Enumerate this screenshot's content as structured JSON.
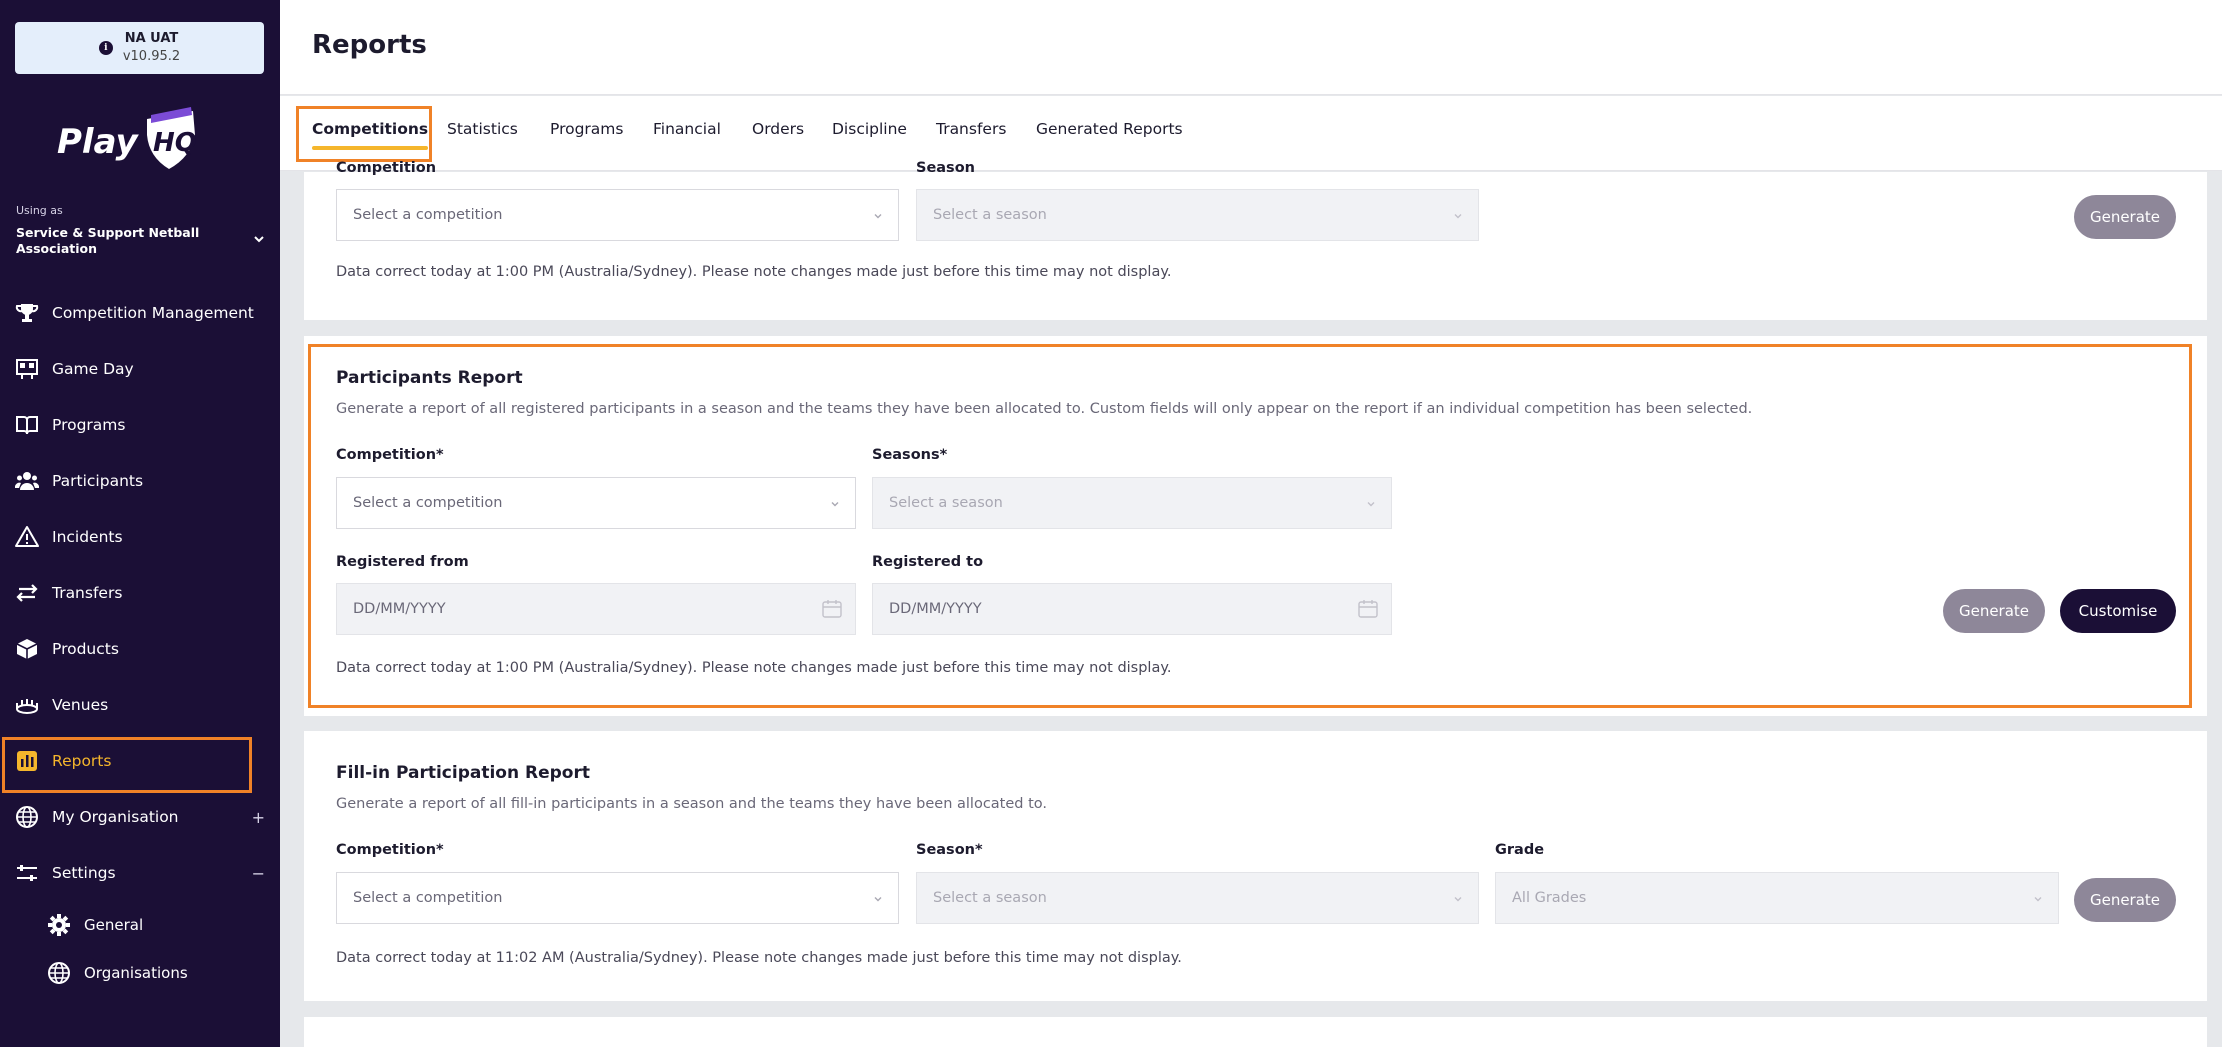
{
  "env": {
    "name": "NA UAT",
    "version": "v10.95.2"
  },
  "brand": {
    "logo_text": "PlayHQ"
  },
  "org": {
    "using_as": "Using as",
    "name": "Service & Support Netball Association"
  },
  "nav": [
    {
      "label": "Competition Management",
      "icon": "trophy-icon"
    },
    {
      "label": "Game Day",
      "icon": "scoreboard-icon"
    },
    {
      "label": "Programs",
      "icon": "book-icon"
    },
    {
      "label": "Participants",
      "icon": "people-icon"
    },
    {
      "label": "Incidents",
      "icon": "warning-icon"
    },
    {
      "label": "Transfers",
      "icon": "arrows-icon"
    },
    {
      "label": "Products",
      "icon": "box-icon"
    },
    {
      "label": "Venues",
      "icon": "stadium-icon"
    },
    {
      "label": "Reports",
      "icon": "reports-icon",
      "active": true
    },
    {
      "label": "My Organisation",
      "icon": "globe-icon",
      "toggle": "+"
    },
    {
      "label": "Settings",
      "icon": "sliders-icon",
      "toggle": "−"
    }
  ],
  "subnav": [
    {
      "label": "General",
      "icon": "gear-icon"
    },
    {
      "label": "Organisations",
      "icon": "globe-icon"
    }
  ],
  "page": {
    "title": "Reports"
  },
  "tabs": [
    {
      "label": "Competitions",
      "active": true
    },
    {
      "label": "Statistics"
    },
    {
      "label": "Programs"
    },
    {
      "label": "Financial"
    },
    {
      "label": "Orders"
    },
    {
      "label": "Discipline"
    },
    {
      "label": "Transfers"
    },
    {
      "label": "Generated Reports"
    }
  ],
  "card1": {
    "competition_label": "Competition",
    "season_label": "Season",
    "competition_placeholder": "Select a competition",
    "season_placeholder": "Select a season",
    "generate": "Generate",
    "note": "Data correct today at 1:00 PM (Australia/Sydney). Please note changes made just before this time may not display."
  },
  "participants": {
    "title": "Participants Report",
    "desc": "Generate a report of all registered participants in a season and the teams they have been allocated to. Custom fields will only appear on the report if an individual competition has been selected.",
    "competition_label": "Competition*",
    "seasons_label": "Seasons*",
    "competition_placeholder": "Select a competition",
    "season_placeholder": "Select a season",
    "registered_from_label": "Registered from",
    "registered_to_label": "Registered to",
    "date_placeholder": "DD/MM/YYYY",
    "generate": "Generate",
    "customise": "Customise",
    "note": "Data correct today at 1:00 PM (Australia/Sydney). Please note changes made just before this time may not display."
  },
  "fillin": {
    "title": "Fill-in Participation Report",
    "desc": "Generate a report of all fill-in participants in a season and the teams they have been allocated to.",
    "competition_label": "Competition*",
    "season_label": "Season*",
    "grade_label": "Grade",
    "competition_placeholder": "Select a competition",
    "season_placeholder": "Select a season",
    "grade_value": "All Grades",
    "generate": "Generate",
    "note": "Data correct today at 11:02 AM (Australia/Sydney). Please note changes made just before this time may not display."
  },
  "colors": {
    "sidebar": "#1b0f36",
    "accent": "#f5b62c",
    "highlight": "#f08227"
  }
}
